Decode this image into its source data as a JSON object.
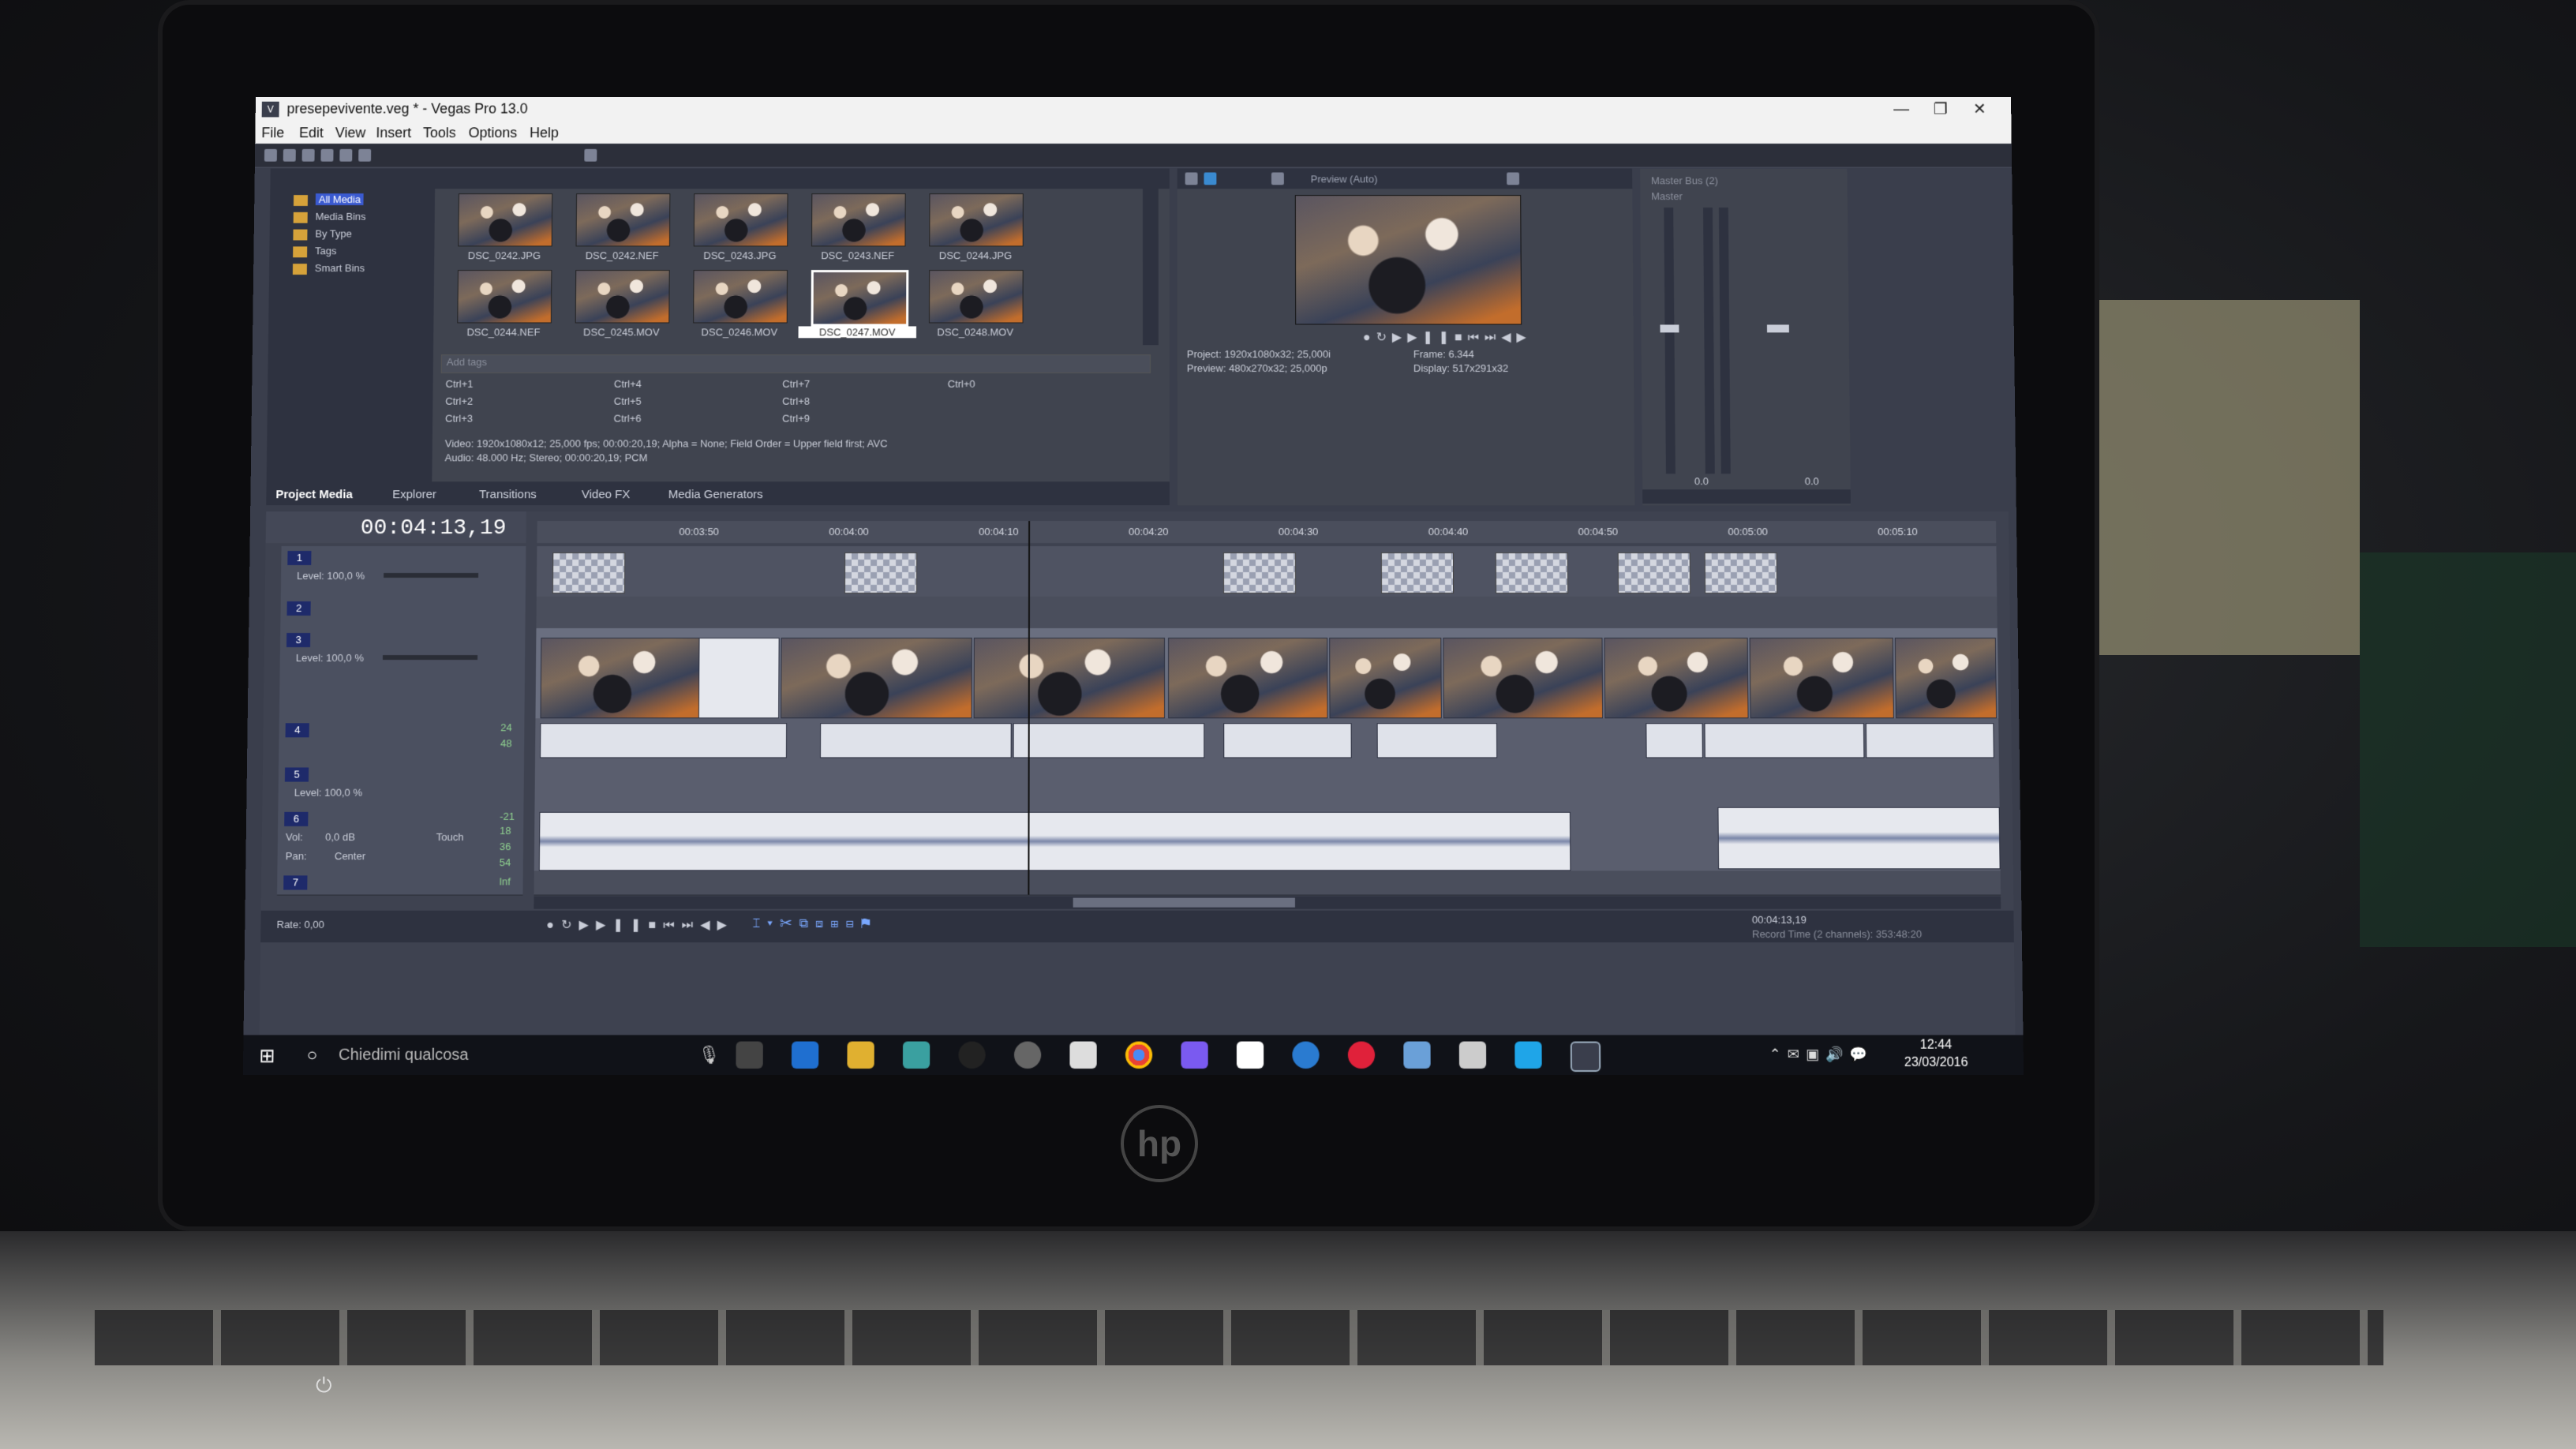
{
  "window": {
    "title": "presepevivente.veg * - Vegas Pro 13.0"
  },
  "menu": [
    "File",
    "Edit",
    "View",
    "Insert",
    "Tools",
    "Options",
    "Help"
  ],
  "media": {
    "tree": [
      "All Media",
      "Media Bins",
      "By Type",
      "Tags",
      "Smart Bins"
    ],
    "thumbnails": [
      "DSC_0242.JPG",
      "DSC_0242.NEF",
      "DSC_0243.JPG",
      "DSC_0243.NEF",
      "DSC_0244.JPG",
      "DSC_0244.NEF",
      "DSC_0245.MOV",
      "DSC_0246.MOV",
      "DSC_0247.MOV",
      "DSC_0248.MOV"
    ],
    "tags_placeholder": "Add tags",
    "shortcuts": [
      "Ctrl+1",
      "Ctrl+4",
      "Ctrl+7",
      "Ctrl+0",
      "Ctrl+2",
      "Ctrl+5",
      "Ctrl+8",
      "Ctrl+3",
      "Ctrl+6",
      "Ctrl+9"
    ],
    "info_video": "Video: 1920x1080x12; 25,000 fps; 00:00:20,19; Alpha = None; Field Order = Upper field first; AVC",
    "info_audio": "Audio: 48.000 Hz; Stereo; 00:00:20,19; PCM",
    "tabs": [
      "Project Media",
      "Explorer",
      "Transitions",
      "Video FX",
      "Media Generators"
    ]
  },
  "preview": {
    "mode": "Preview (Auto)",
    "project": "Project:  1920x1080x32; 25,000i",
    "preview": "Preview:  480x270x32; 25,000p",
    "frame": "Frame:    6.344",
    "display": "Display:  517x291x32"
  },
  "master": {
    "title": "Master Bus (2)",
    "tab": "Master",
    "readout_l": "0.0",
    "readout_r": "0.0"
  },
  "timeline": {
    "timecode": "00:04:13,19",
    "ruler": [
      "00:03:50",
      "00:04:00",
      "00:04:10",
      "00:04:20",
      "00:04:30",
      "00:04:40",
      "00:04:50",
      "00:05:00",
      "00:05:10"
    ],
    "playhead_progress": 0.337,
    "tracks": [
      {
        "num": "1",
        "level": "Level: 100,0 %"
      },
      {
        "num": "2",
        "level": ""
      },
      {
        "num": "3",
        "level": "Level: 100,0 %"
      },
      {
        "num": "4",
        "level": ""
      },
      {
        "num": "5",
        "level": "Level: 100,0 %"
      },
      {
        "num": "6",
        "vol": "Vol:",
        "vol_val": "0,0 dB",
        "touch": "Touch",
        "pan": "Pan:",
        "pan_val": "Center"
      },
      {
        "num": "7",
        "level": ""
      }
    ],
    "meter_scale": [
      "24",
      "48",
      "-21",
      "18",
      "36",
      "54",
      "Inf"
    ],
    "rate": "Rate: 0,00",
    "end_timecode": "00:04:13,19",
    "record_time": "Record Time (2 channels): 353:48:20"
  },
  "taskbar": {
    "search_placeholder": "Chiedimi qualcosa",
    "time": "12:44",
    "date": "23/03/2016"
  },
  "colors": {
    "accent": "#3a5ad0",
    "bg": "#3a3e4c",
    "panel": "#40444f"
  }
}
